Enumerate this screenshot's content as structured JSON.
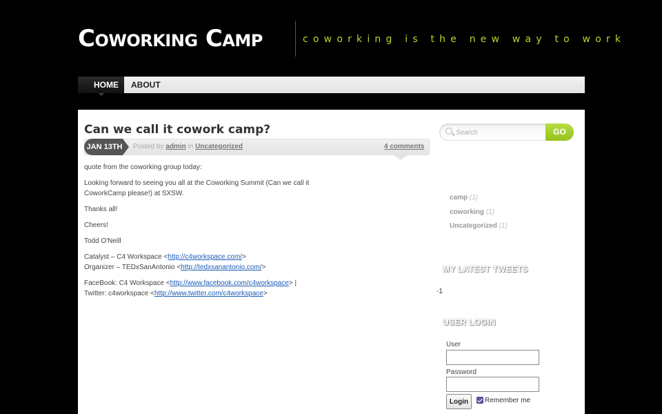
{
  "header": {
    "site_title": "Coworking Camp",
    "tagline": "coworking is the new way to work",
    "tagline_color": "#b8d430"
  },
  "nav": {
    "items": [
      {
        "label": "HOME",
        "active": true
      },
      {
        "label": "ABOUT",
        "active": false
      }
    ]
  },
  "post": {
    "title": "Can we call it cowork camp?",
    "date": "JAN 13TH",
    "posted_by_prefix": "Posted by",
    "author": "admin",
    "in_word": "in",
    "category": "Uncategorized",
    "comments": "4 comments",
    "body": {
      "p1": "quote from the coworking group today:",
      "p2": "Looking forward to seeing you all at the Coworking Summit (Can we call it CoworkCamp please!) at SXSW.",
      "p3": "Thanks all!",
      "p4": "Cheers!",
      "p5": "Todd O'Neill",
      "catalyst_prefix": "Catalyst – C4 Workspace <",
      "catalyst_link": "http://c4workspace.com/",
      "catalyst_suffix": ">",
      "organizer_prefix": "Organizer – TEDxSanAntonio <",
      "organizer_link": "http://tedxsanantonio.com/",
      "organizer_suffix": ">",
      "facebook_prefix": "FaceBook: C4 Workspace <",
      "facebook_link": "http://www.facebook.com/c4workspace",
      "facebook_suffix": "> | Twitter: c4workspace <",
      "twitter_link": "http://www.twitter.com/c4workspace",
      "twitter_suffix": ">"
    }
  },
  "sidebar": {
    "search": {
      "placeholder": "Search",
      "button": "GO",
      "button_color": "#a4cf2e"
    },
    "categories": [
      {
        "name": "camp",
        "count": "(1)"
      },
      {
        "name": "coworking",
        "count": "(1)"
      },
      {
        "name": "Uncategorized",
        "count": "(1)"
      }
    ],
    "tweets": {
      "title": "MY LATEST TWEETS",
      "text": "-1"
    },
    "login": {
      "title": "USER LOGIN",
      "user_label": "User",
      "password_label": "Password",
      "login_button": "Login",
      "remember_label": "Remember me",
      "remember_checked": true
    }
  }
}
